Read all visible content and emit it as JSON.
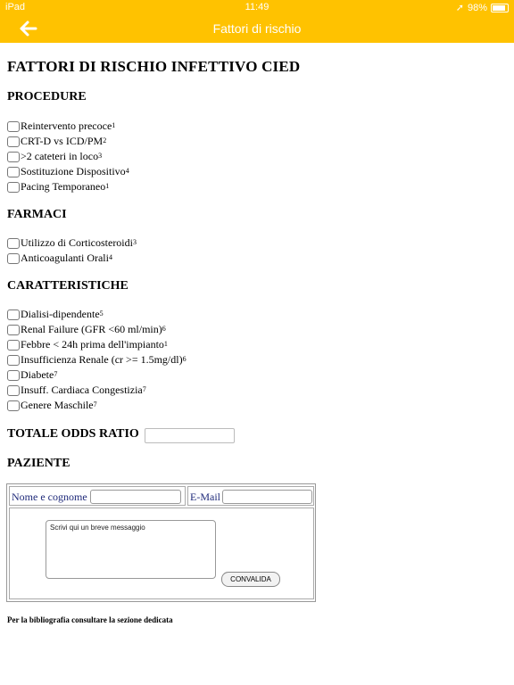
{
  "status": {
    "device": "iPad",
    "time": "11:49",
    "battery": "98%"
  },
  "nav": {
    "title": "Fattori di rischio",
    "back_icon": "arrow-left-icon"
  },
  "page_title": "FATTORI DI RISCHIO INFETTIVO CIED",
  "sections": {
    "procedure": {
      "title": "PROCEDURE",
      "items": [
        {
          "label": "Reintervento precoce",
          "ref": "1"
        },
        {
          "label": "CRT-D vs ICD/PM",
          "ref": "2"
        },
        {
          "label": ">2 cateteri in loco",
          "ref": "3"
        },
        {
          "label": "Sostituzione Dispositivo",
          "ref": "4"
        },
        {
          "label": "Pacing Temporaneo ",
          "ref": "1"
        }
      ]
    },
    "farmaci": {
      "title": "FARMACI",
      "items": [
        {
          "label": "Utilizzo di Corticosteroidi",
          "ref": "3"
        },
        {
          "label": "Anticoagulanti Orali",
          "ref": "4"
        }
      ]
    },
    "caratteristiche": {
      "title": "CARATTERISTICHE",
      "items": [
        {
          "label": "Dialisi-dipendente",
          "ref": "5"
        },
        {
          "label": "Renal Failure (GFR <60 ml/min)",
          "ref": "6"
        },
        {
          "label": "Febbre < 24h prima dell'impianto ",
          "ref": "1"
        },
        {
          "label": "Insufficienza Renale (cr >= 1.5mg/dl)",
          "ref": "6"
        },
        {
          "label": "Diabete",
          "ref": "7"
        },
        {
          "label": "Insuff. Cardiaca Congestizia",
          "ref": "7"
        },
        {
          "label": "Genere Maschile",
          "ref": "7"
        }
      ]
    }
  },
  "totale": {
    "label": "TOTALE ODDS RATIO",
    "value": ""
  },
  "paziente": {
    "title": "PAZIENTE",
    "name_label": "Nome e cognome",
    "email_label": "E-Mail",
    "message_placeholder": "Scrivi qui un breve messaggio",
    "submit_label": "CONVALIDA"
  },
  "footer_note": "Per la bibliografia consultare la sezione dedicata"
}
